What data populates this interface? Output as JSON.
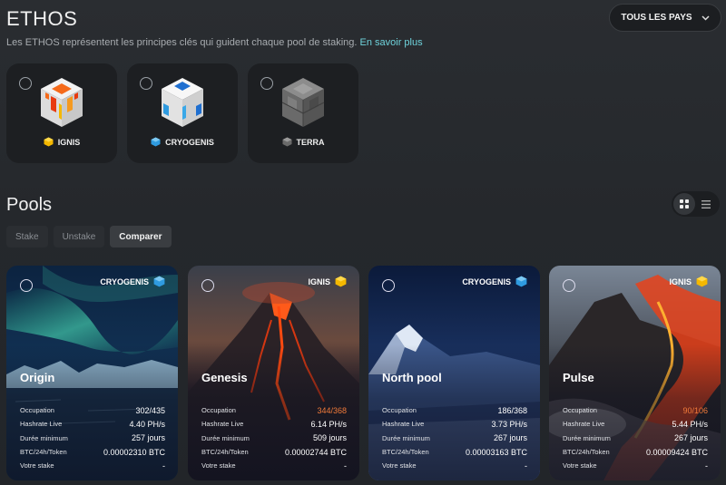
{
  "header": {
    "title": "ETHOS",
    "subtitle": "Les ETHOS représentent les principes clés qui guident chaque pool de staking.",
    "learn_more": "En savoir plus",
    "country_select": "TOUS LES PAYS"
  },
  "ethos": [
    {
      "label": "IGNIS",
      "icon": "ignis-cube-icon"
    },
    {
      "label": "CRYOGENIS",
      "icon": "cryogenis-cube-icon"
    },
    {
      "label": "TERRA",
      "icon": "terra-cube-icon"
    }
  ],
  "pools_section": {
    "title": "Pools",
    "tabs": [
      {
        "label": "Stake",
        "active": false
      },
      {
        "label": "Unstake",
        "active": false
      },
      {
        "label": "Comparer",
        "active": true
      }
    ],
    "view": "grid"
  },
  "stat_labels": {
    "occupation": "Occupation",
    "hashrate": "Hashrate Live",
    "duration": "Durée minimum",
    "btc": "BTC/24h/Token",
    "stake": "Votre stake"
  },
  "pools": [
    {
      "name": "Origin",
      "ethos": "CRYOGENIS",
      "occupation": "302/435",
      "hashrate": "4.40 PH/s",
      "duration": "257 jours",
      "btc": "0.00002310 BTC",
      "stake": "-"
    },
    {
      "name": "Genesis",
      "ethos": "IGNIS",
      "occupation": "344/368",
      "hashrate": "6.14 PH/s",
      "duration": "509 jours",
      "btc": "0.00002744 BTC",
      "stake": "-"
    },
    {
      "name": "North pool",
      "ethos": "CRYOGENIS",
      "occupation": "186/368",
      "hashrate": "3.73 PH/s",
      "duration": "267 jours",
      "btc": "0.00003163 BTC",
      "stake": "-"
    },
    {
      "name": "Pulse",
      "ethos": "IGNIS",
      "occupation": "90/106",
      "hashrate": "5.44 PH/s",
      "duration": "267 jours",
      "btc": "0.00009424 BTC",
      "stake": "-"
    }
  ],
  "colors": {
    "accent_link": "#6fd3dc",
    "ignis": "#f5b800",
    "cryogenis": "#2f9be0",
    "terra": "#7a7a7a",
    "high_occupation": "#f07a3a"
  }
}
